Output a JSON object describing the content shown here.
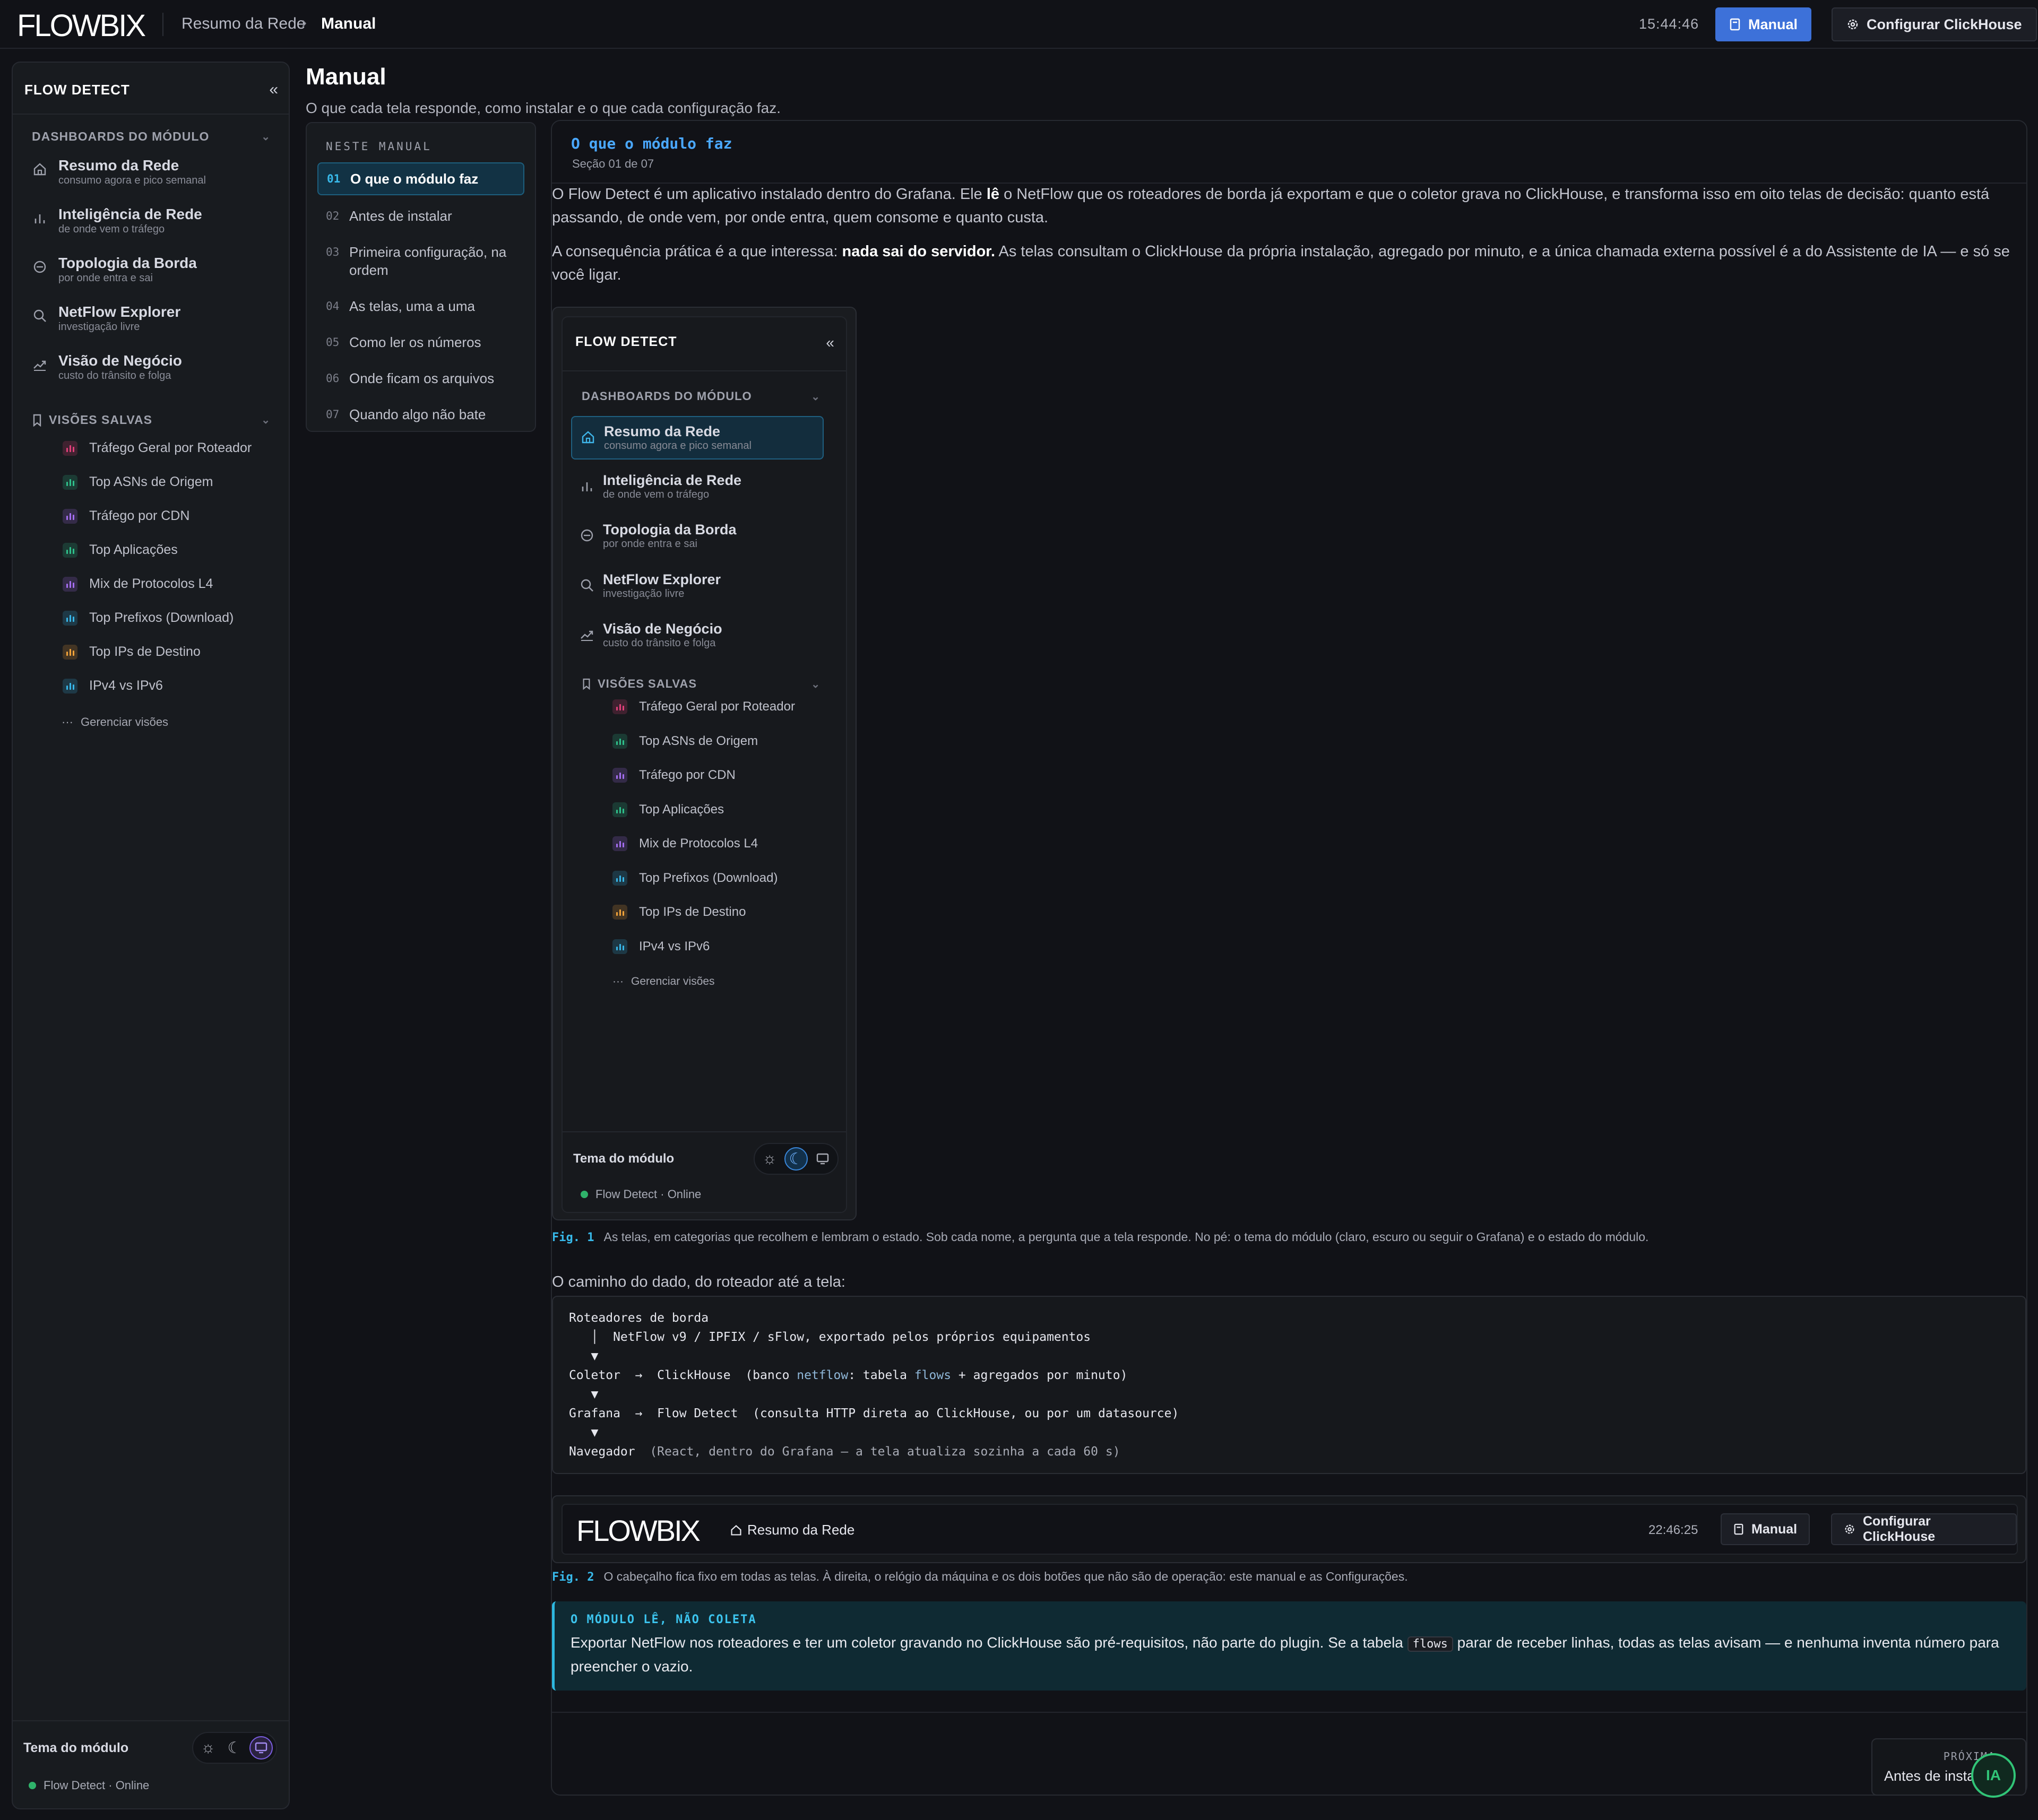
{
  "topbar": {
    "logo": "FLOWBIX",
    "breadcrumb": [
      "Resumo da Rede",
      "Manual"
    ],
    "clock": "15:44:46",
    "manual_btn": "Manual",
    "config_btn": "Configurar ClickHouse",
    "accent": "#3d71d9"
  },
  "sidebar": {
    "title": "FLOW DETECT",
    "dash_section": "DASHBOARDS DO MÓDULO",
    "dashboards": [
      {
        "title": "Resumo da Rede",
        "subtitle": "consumo agora e pico semanal",
        "icon": "home-icon"
      },
      {
        "title": "Inteligência de Rede",
        "subtitle": "de onde vem o tráfego",
        "icon": "bar-chart-icon"
      },
      {
        "title": "Topologia da Borda",
        "subtitle": "por onde entra e sai",
        "icon": "circle-minus-icon"
      },
      {
        "title": "NetFlow Explorer",
        "subtitle": "investigação livre",
        "icon": "search-icon"
      },
      {
        "title": "Visão de Negócio",
        "subtitle": "custo do trânsito e folga",
        "icon": "trend-icon"
      }
    ],
    "saved_section": "VISÕES SALVAS",
    "saved": [
      {
        "label": "Tráfego Geral por Roteador",
        "color": "#e0407a"
      },
      {
        "label": "Top ASNs de Origem",
        "color": "#2fbf8a"
      },
      {
        "label": "Tráfego por CDN",
        "color": "#a46ef0"
      },
      {
        "label": "Top Aplicações",
        "color": "#2fbf8a"
      },
      {
        "label": "Mix de Protocolos L4",
        "color": "#a46ef0"
      },
      {
        "label": "Top Prefixos (Download)",
        "color": "#38b6e8"
      },
      {
        "label": "Top IPs de Destino",
        "color": "#f0a23a"
      },
      {
        "label": "IPv4 vs IPv6",
        "color": "#38b6e8"
      }
    ],
    "manage": "Gerenciar visões",
    "theme_label": "Tema do módulo",
    "status": "Flow Detect · Online"
  },
  "page": {
    "title": "Manual",
    "subtitle": "O que cada tela responde, como instalar e o que cada configuração faz."
  },
  "toc": {
    "title": "NESTE MANUAL",
    "items": [
      {
        "num": "01",
        "label": "O que o módulo faz"
      },
      {
        "num": "02",
        "label": "Antes de instalar"
      },
      {
        "num": "03",
        "label": "Primeira configuração, na ordem"
      },
      {
        "num": "04",
        "label": "As telas, uma a uma"
      },
      {
        "num": "05",
        "label": "Como ler os números"
      },
      {
        "num": "06",
        "label": "Onde ficam os arquivos"
      },
      {
        "num": "07",
        "label": "Quando algo não bate"
      }
    ]
  },
  "section": {
    "name": "O que o módulo faz",
    "count": "Seção 01 de 07",
    "p1_a": "O Flow Detect é um aplicativo instalado dentro do Grafana. Ele ",
    "p1_b": "lê",
    "p1_c": " o NetFlow que os roteadores de borda já exportam e que o coletor grava no ClickHouse, e transforma isso em oito telas de decisão: quanto está passando, de onde vem, por onde entra, quem consome e quanto custa.",
    "p2_a": "A consequência prática é a que interessa: ",
    "p2_b": "nada sai do servidor.",
    "p2_c": " As telas consultam o ClickHouse da própria instalação, agregado por minuto, e a única chamada externa possível é a do Assistente de IA — e só se você ligar.",
    "fig1_label": "Fig. 1",
    "fig1_caption": "As telas, em categorias que recolhem e lembram o estado. Sob cada nome, a pergunta que a tela responde. No pé: o tema do módulo (claro, escuro ou seguir o Grafana) e o estado do módulo.",
    "path_intro": "O caminho do dado, do roteador até a tela:",
    "code": {
      "l1": "Roteadores de borda",
      "l2": "   │  NetFlow v9 / IPFIX / sFlow, exportado pelos próprios equipamentos",
      "l3": "   ▼",
      "l4a": "Coletor  →  ClickHouse  (banco ",
      "l4b": "netflow",
      "l4c": ": tabela ",
      "l4d": "flows",
      "l4e": " + agregados por minuto)",
      "l5": "   ▼",
      "l6": "Grafana  →  Flow Detect  (consulta HTTP direta ao ClickHouse, ou por um datasource)",
      "l7": "   ▼",
      "l8a": "Navegador  ",
      "l8b": "(React, dentro do Grafana — a tela atualiza sozinha a cada 60 s)"
    },
    "fig2": {
      "logo": "FLOWBIX",
      "crumb": "Resumo da Rede",
      "clock": "22:46:25",
      "manual": "Manual",
      "config": "Configurar ClickHouse"
    },
    "fig2_label": "Fig. 2",
    "fig2_caption": "O cabeçalho fica fixo em todas as telas. À direita, o relógio da máquina e os dois botões que não são de operação: este manual e as Configurações.",
    "callout_title": "O MÓDULO LÊ, NÃO COLETA",
    "callout_a": "Exportar NetFlow nos roteadores e ter um coletor gravando no ClickHouse são pré-requisitos, não parte do plugin. Se a tabela ",
    "callout_code": "flows",
    "callout_b": " parar de receber linhas, todas as telas avisam — e nenhuma inventa número para preencher o vazio.",
    "next_kicker": "PRÓXIMA",
    "next_label": "Antes de insta"
  },
  "assistant": "IA"
}
